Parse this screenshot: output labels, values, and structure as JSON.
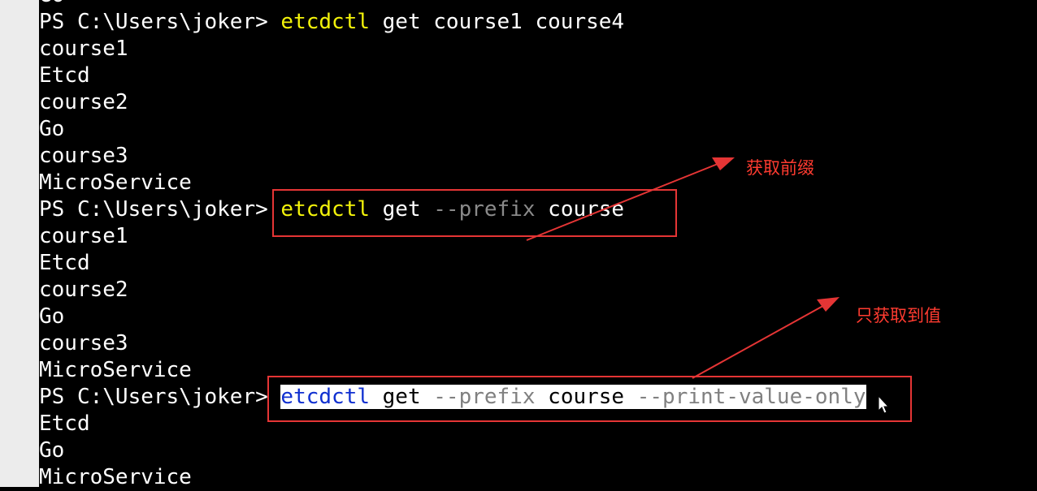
{
  "terminal": {
    "top_line": "Go",
    "prompt": "PS C:\\Users\\joker> ",
    "commands": {
      "first": {
        "cmd": "etcdctl",
        "rest": " get course1 course4"
      },
      "second": {
        "cmd": "etcdctl",
        "get": " get ",
        "flag": "--prefix",
        "arg": " course"
      },
      "third": {
        "cmd": "etcdctl",
        "get": " get ",
        "flag1": "--prefix",
        "arg": " course ",
        "flag2": "--print-value-only"
      }
    },
    "output1": [
      "course1",
      "Etcd",
      "course2",
      "Go",
      "course3",
      "MicroService"
    ],
    "output2": [
      "course1",
      "Etcd",
      "course2",
      "Go",
      "course3",
      "MicroService"
    ],
    "output3": [
      "Etcd",
      "Go",
      "MicroService"
    ]
  },
  "annotations": {
    "prefix_note": "获取前缀",
    "value_only_note": "只获取到值",
    "accent_color": "#e53535"
  }
}
